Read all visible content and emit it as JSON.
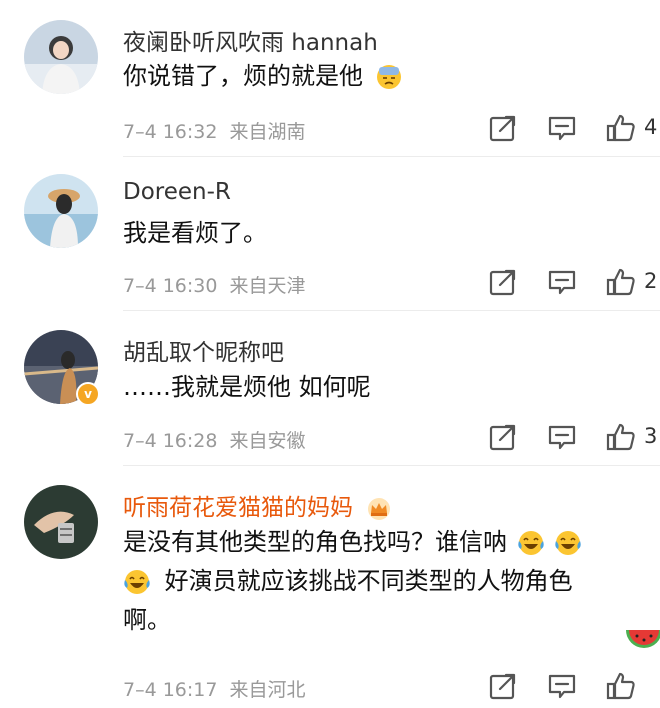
{
  "comments": [
    {
      "user": "夜阑卧听风吹雨 hannah",
      "text": "你说错了，烦的就是他",
      "time": "7–4 16:32",
      "location": "来自湖南",
      "likes": "4",
      "emoji_icon": "cold-sweat-emoji-icon",
      "verified": false,
      "vip": false
    },
    {
      "user": "Doreen-R",
      "text": "我是看烦了。",
      "time": "7–4 16:30",
      "location": "来自天津",
      "likes": "2",
      "verified": false,
      "vip": false
    },
    {
      "user": "胡乱取个昵称吧",
      "text": "……我就是烦他 如何呢",
      "time": "7–4 16:28",
      "location": "来自安徽",
      "likes": "3",
      "verified": true,
      "vip": false
    },
    {
      "user": "听雨荷花爱猫猫的妈妈",
      "text_line1": "是没有其他类型的角色找吗？谁信呐",
      "text_line2": "好演员就应该挑战不同类型的人物角色",
      "text_line3": "啊。",
      "time": "7–4 16:17",
      "location": "来自河北",
      "likes": "",
      "emoji_icon": "crying-laughing-emoji-icon",
      "verified": false,
      "vip": true
    }
  ],
  "colors": {
    "vip_name": "#e8590c",
    "meta_text": "#999999",
    "verified_badge": "#f5a623"
  }
}
